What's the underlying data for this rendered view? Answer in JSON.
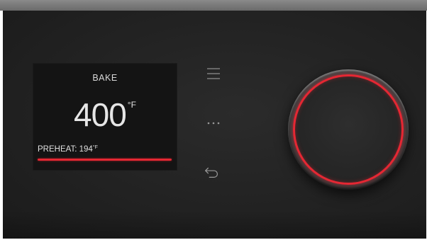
{
  "display": {
    "mode": "BAKE",
    "temperature": "400",
    "temperature_unit": "°F",
    "preheat_label": "PREHEAT: 194",
    "preheat_unit": "°F",
    "preheat_progress": 1.0
  },
  "controls": {
    "menu_icon": "menu-icon",
    "more_icon": "more-icon",
    "back_icon": "back-icon",
    "knob_icon": "dial-knob"
  },
  "colors": {
    "accent": "#e52733",
    "display_background": "#141414",
    "panel_background": "#242424",
    "text": "#e6e6e6"
  }
}
